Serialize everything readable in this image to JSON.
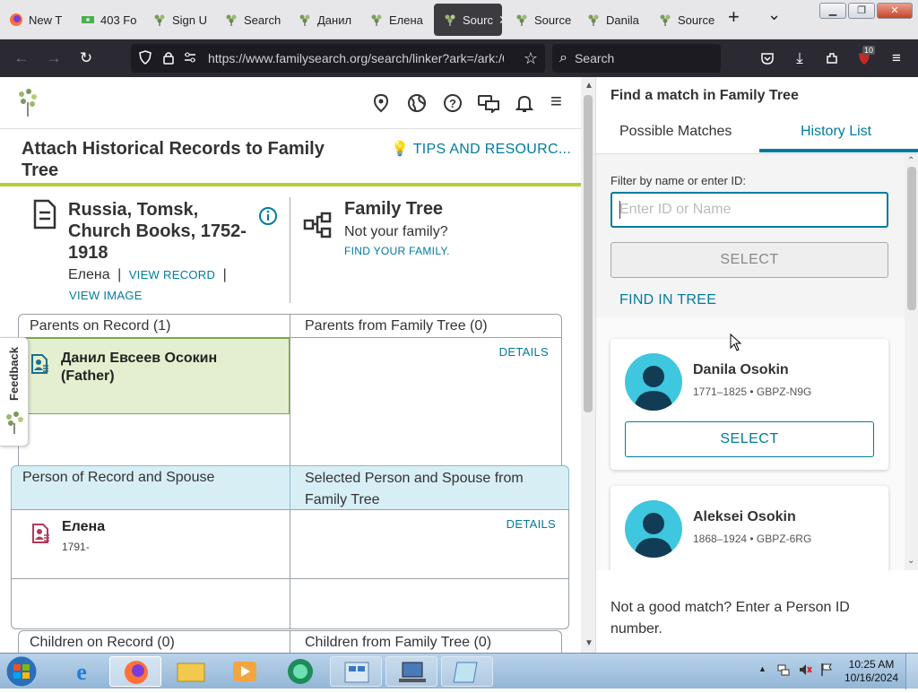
{
  "browser": {
    "tabs": [
      {
        "label": "New T",
        "icon": "firefox-icon"
      },
      {
        "label": "403 Fo",
        "icon": "money-icon"
      },
      {
        "label": "Sign U",
        "icon": "familysearch-tree-icon"
      },
      {
        "label": "Search",
        "icon": "familysearch-tree-icon"
      },
      {
        "label": "Данил",
        "icon": "familysearch-tree-icon"
      },
      {
        "label": "Елена",
        "icon": "familysearch-tree-icon"
      },
      {
        "label": "Sourc",
        "icon": "familysearch-tree-icon",
        "active": true
      },
      {
        "label": "Source",
        "icon": "familysearch-tree-icon"
      },
      {
        "label": "Danila",
        "icon": "familysearch-tree-icon"
      },
      {
        "label": "Source",
        "icon": "familysearch-tree-icon"
      }
    ],
    "new_tab": "+",
    "list_tabs": "⌄",
    "url": "https://www.familysearch.org/search/linker?ark=/ark:/6",
    "url_domain": "familysearch.org",
    "search_placeholder": "Search",
    "badge_count": "10"
  },
  "page": {
    "title": "Attach Historical Records to Family Tree",
    "tips": "TIPS AND RESOURC...",
    "record": {
      "collection": "Russia, Tomsk, Church Books, 1752-1918",
      "person": "Елена",
      "view_record": "VIEW RECORD",
      "view_image": "VIEW IMAGE",
      "sep": "|"
    },
    "family_tree": {
      "title": "Family Tree",
      "subtitle": "Not your family?",
      "link": "FIND YOUR FAMILY."
    },
    "parents_record_hdr": "Parents on Record (1)",
    "parents_tree_hdr": "Parents from Family Tree (0)",
    "father": "Данил Евсеев Осокин (Father)",
    "details_label": "DETAILS",
    "spouse_record_hdr": "Person of Record and Spouse",
    "spouse_tree_hdr": "Selected Person and Spouse from Family Tree",
    "person_name": "Елена",
    "person_years": "1791-",
    "children_record_hdr": "Children on Record (0)",
    "children_tree_hdr": "Children from Family Tree (0)",
    "feedback": "Feedback"
  },
  "panel": {
    "title": "Find a match in Family Tree",
    "tab_possible": "Possible Matches",
    "tab_history": "History List",
    "filter_label": "Filter by name or enter ID:",
    "filter_placeholder": "Enter ID or Name",
    "select_label": "SELECT",
    "find_in_tree": "FIND IN TREE",
    "matches": [
      {
        "name": "Danila Osokin",
        "meta": "1771–1825 • GBPZ-N9G",
        "select": "SELECT"
      },
      {
        "name": "Aleksei Osokin",
        "meta": "1868–1924 • GBPZ-6RG"
      }
    ],
    "footer": "Not a good match? Enter a Person ID number."
  },
  "taskbar": {
    "time": "10:25 AM",
    "date": "10/16/2024",
    "apps": [
      "ie-icon",
      "firefox-icon",
      "explorer-icon",
      "media-player-icon",
      "green-globe-icon",
      "control-panel-icon",
      "network-icon",
      "notepad-icon"
    ]
  },
  "colors": {
    "accent": "#007b9e",
    "green_rule": "#b6cb3b",
    "father_cell": "#e3efcf",
    "spouse_header": "#d7eef5",
    "avatar": "#3ec7df"
  }
}
